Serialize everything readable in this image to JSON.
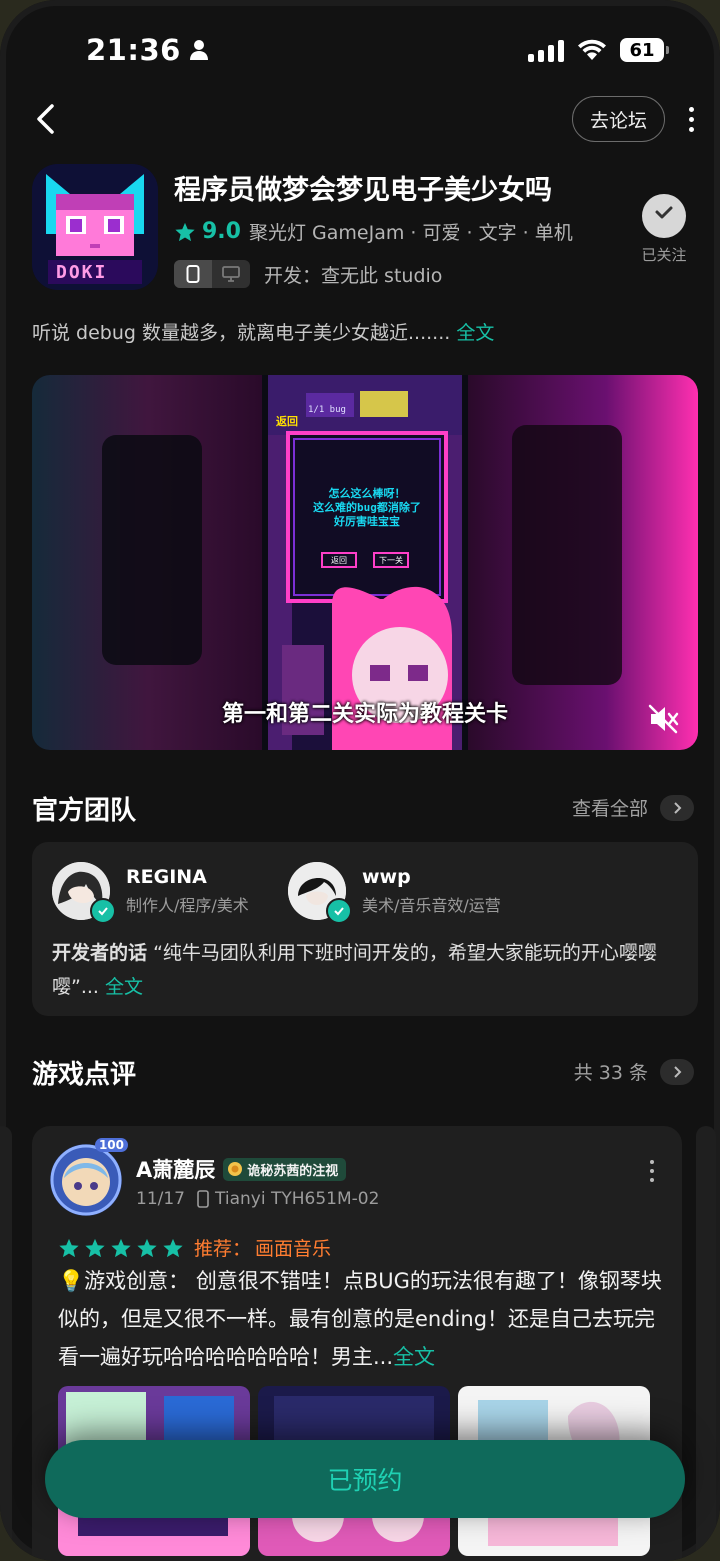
{
  "status": {
    "time": "21:36",
    "battery": "61"
  },
  "topbar": {
    "forum_label": "去论坛"
  },
  "game": {
    "title": "程序员做梦会梦见电子美少女吗",
    "rating": "9.0",
    "tags": "聚光灯 GameJam · 可爱 · 文字 · 单机",
    "developer_label": "开发：",
    "developer": "查无此 studio",
    "follow_label": "已关注",
    "description": "听说 debug 数量越多，就离电子美少女越近.......",
    "description_more": "全文",
    "icon_text": "DOKI",
    "accent": "#17c0a6"
  },
  "video": {
    "subtitle": "第一和第二关实际为教程关卡",
    "screen_lines": [
      "怎么这么棒呀！",
      "这么难的bug都消除了",
      "好厉害哇宝宝"
    ],
    "btn_back": "返回",
    "btn_next": "下一关",
    "top_label": "返回",
    "bug_label": "1/1 bug"
  },
  "team": {
    "title": "官方团队",
    "more": "查看全部",
    "members": [
      {
        "name": "REGINA",
        "role": "制作人/程序/美术"
      },
      {
        "name": "wwp",
        "role": "美术/音乐音效/运营"
      }
    ],
    "dev_words_label": "开发者的话",
    "dev_words": "“纯牛马团队利用下班时间开发的，希望大家能玩的开心嘤嘤嘤”...",
    "dev_words_more": "全文"
  },
  "reviews": {
    "title": "游戏点评",
    "count": "共 33 条",
    "items": [
      {
        "user": "A萧麓辰",
        "tag": "诡秘苏茜的注视",
        "date": "11/17",
        "device": "Tianyi TYH651M-02",
        "stars": 5,
        "recommend_label": "推荐：",
        "recommend": "画面音乐",
        "body": "💡游戏创意： 创意很不错哇！点BUG的玩法很有趣了！像钢琴块似的，但是又很不一样。最有创意的是ending！还是自己去玩完看一遍好玩哈哈哈哈哈哈哈！男主...",
        "more": "全文",
        "avatar_badge": "100"
      }
    ]
  },
  "cta": {
    "label": "已预约"
  }
}
